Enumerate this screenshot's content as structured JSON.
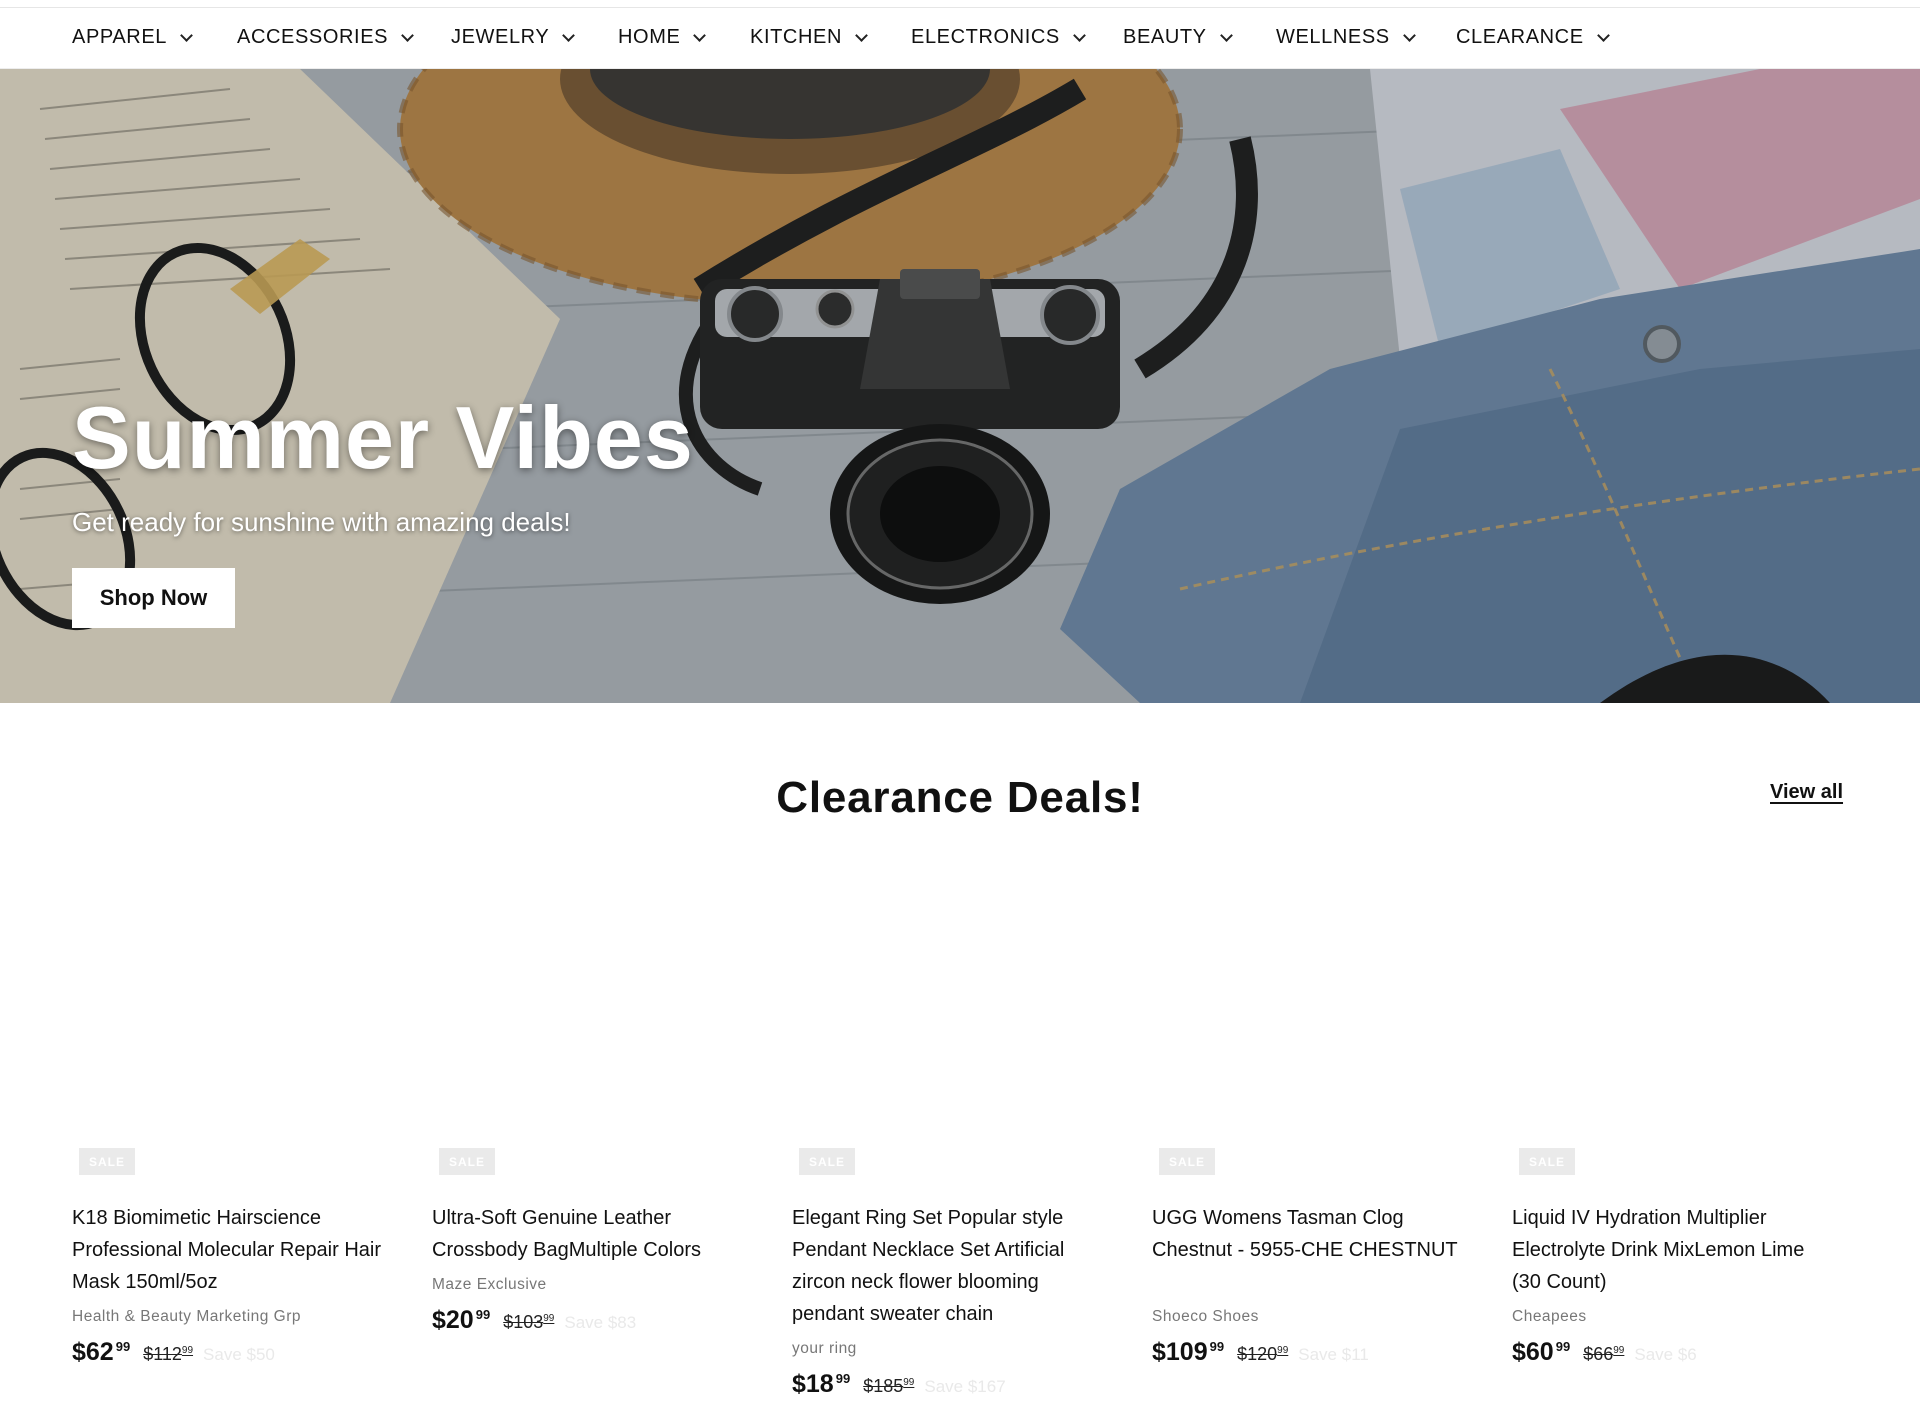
{
  "nav": {
    "items": [
      {
        "label": "APPAREL"
      },
      {
        "label": "ACCESSORIES"
      },
      {
        "label": "JEWELRY"
      },
      {
        "label": "HOME"
      },
      {
        "label": "KITCHEN"
      },
      {
        "label": "ELECTRONICS"
      },
      {
        "label": "BEAUTY"
      },
      {
        "label": "WELLNESS"
      },
      {
        "label": "CLEARANCE"
      }
    ],
    "dropdown_icon": "chevron-down-icon"
  },
  "hero": {
    "title": "Summer Vibes",
    "subtitle": "Get ready for sunshine with amazing deals!",
    "button_label": "Shop Now"
  },
  "section": {
    "title": "Clearance Deals!",
    "view_all_label": "View all"
  },
  "products": [
    {
      "badge": "SALE",
      "title": "K18 Biomimetic Hairscience Professional Molecular Repair Hair Mask 150ml/5oz",
      "vendor": "Health & Beauty Marketing Grp",
      "price": "$62",
      "price_cents": "99",
      "compare": "$112",
      "compare_cents": "99",
      "save": "Save $50"
    },
    {
      "badge": "SALE",
      "title": "Ultra-Soft Genuine Leather Crossbody BagMultiple Colors",
      "vendor": "Maze Exclusive",
      "price": "$20",
      "price_cents": "99",
      "compare": "$103",
      "compare_cents": "99",
      "save": "Save $83"
    },
    {
      "badge": "SALE",
      "title": "Elegant Ring Set Popular style Pendant Necklace Set Artificial zircon neck flower blooming pendant sweater chain",
      "vendor": "your ring",
      "price": "$18",
      "price_cents": "99",
      "compare": "$185",
      "compare_cents": "99",
      "save": "Save $167"
    },
    {
      "badge": "SALE",
      "title": "UGG Womens Tasman Clog Chestnut - 5955-CHE CHESTNUT",
      "vendor": "Shoeco Shoes",
      "price": "$109",
      "price_cents": "99",
      "compare": "$120",
      "compare_cents": "99",
      "save": "Save $11"
    },
    {
      "badge": "SALE",
      "title": "Liquid IV Hydration Multiplier Electrolyte Drink MixLemon Lime (30 Count)",
      "vendor": "Cheapees",
      "price": "$60",
      "price_cents": "99",
      "compare": "$66",
      "compare_cents": "99",
      "save": "Save $6"
    }
  ]
}
